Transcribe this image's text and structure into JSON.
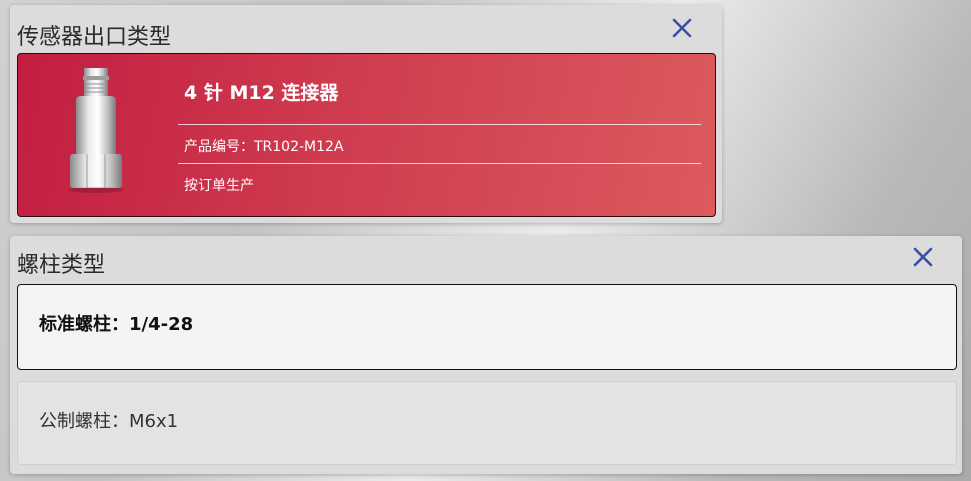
{
  "colors": {
    "close_icon": "#3a4fa8",
    "selected_card_gradient_start": "#c21e42",
    "selected_card_gradient_end": "#dc5a5e",
    "selected_border": "#111111"
  },
  "sensor_output_panel": {
    "title": "传感器出口类型",
    "close_icon": "close-icon",
    "selected_option": {
      "title": "4 针 M12 连接器",
      "product_code": "产品编号：TR102-M12A",
      "availability": "按订单生产"
    }
  },
  "stud_panel": {
    "title": "螺柱类型",
    "close_icon": "close-icon",
    "options": [
      {
        "label": "标准螺柱：1/4-28",
        "selected": true
      },
      {
        "label": "公制螺柱：M6x1",
        "selected": false
      }
    ]
  }
}
